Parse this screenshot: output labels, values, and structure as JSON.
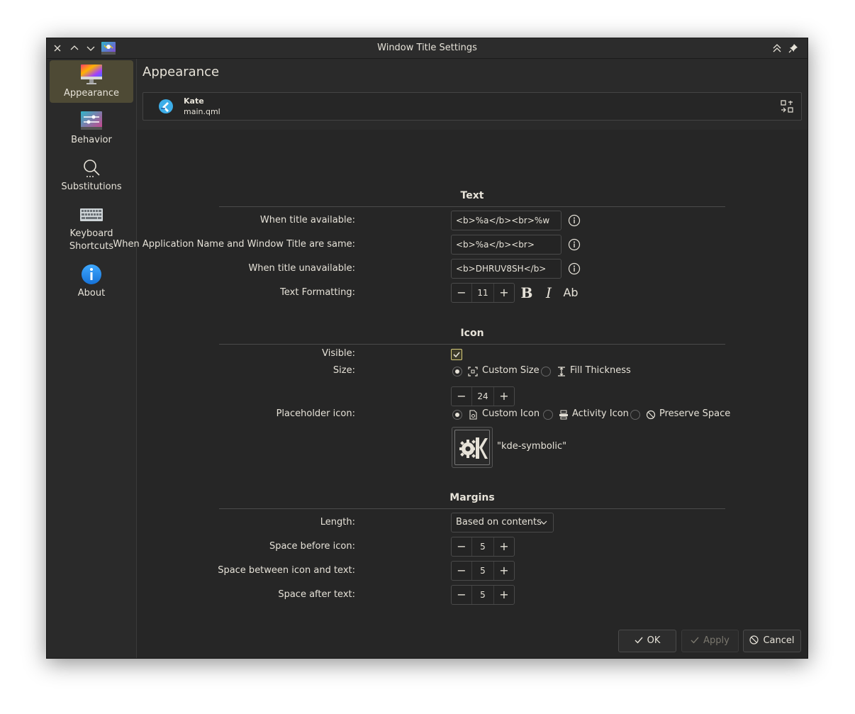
{
  "window": {
    "title": "Window Title Settings"
  },
  "sidebar": {
    "items": [
      {
        "label": "Appearance",
        "icon": "appearance-icon",
        "active": true
      },
      {
        "label": "Behavior",
        "icon": "behavior-icon"
      },
      {
        "label": "Substitutions",
        "icon": "search-icon"
      },
      {
        "label": "Keyboard Shortcuts",
        "icon": "keyboard-icon"
      },
      {
        "label": "About",
        "icon": "about-icon"
      }
    ]
  },
  "page": {
    "title": "Appearance"
  },
  "preview": {
    "app_name": "Kate",
    "file_name": "main.qml"
  },
  "text_section": {
    "title": "Text",
    "rows": [
      {
        "label": "When title available:",
        "value": "<b>%a</b><br>%w"
      },
      {
        "label": "When Application Name and Window Title are same:",
        "value": "<b>%a</b><br>"
      },
      {
        "label": "When title unavailable:",
        "value": "<b>DHRUV8SH</b>"
      }
    ],
    "formatting_label": "Text Formatting:",
    "font_size": "11",
    "bold": "B",
    "italic": "I",
    "case": "Ab"
  },
  "icon_section": {
    "title": "Icon",
    "visible_label": "Visible:",
    "visible": true,
    "size_label": "Size:",
    "size_options": [
      "Custom Size",
      "Fill Thickness"
    ],
    "size_selected": "Custom Size",
    "size_value": "24",
    "placeholder_label": "Placeholder icon:",
    "placeholder_options": [
      "Custom Icon",
      "Activity Icon",
      "Preserve Space"
    ],
    "placeholder_selected": "Custom Icon",
    "icon_name": "\"kde-symbolic\""
  },
  "margins_section": {
    "title": "Margins",
    "length_label": "Length:",
    "length_value": "Based on contents",
    "rows": [
      {
        "label": "Space before icon:",
        "value": "5"
      },
      {
        "label": "Space between icon and text:",
        "value": "5"
      },
      {
        "label": "Space after text:",
        "value": "5"
      }
    ]
  },
  "buttons": {
    "ok": "OK",
    "apply": "Apply",
    "cancel": "Cancel"
  },
  "colors": {
    "accent": "#d8cc7a",
    "active_sidebar": "#4e4a35",
    "background": "#2a2a2a"
  }
}
